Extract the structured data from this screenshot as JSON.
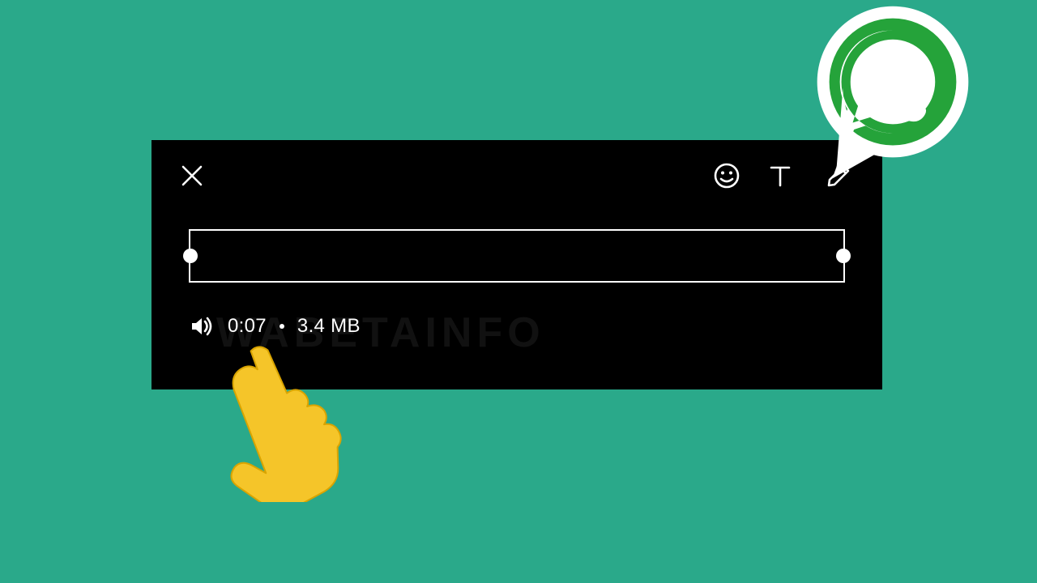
{
  "media": {
    "duration": "0:07",
    "size": "3.4 MB"
  },
  "watermark": "WABETAINFO",
  "icons": {
    "close": "close-icon",
    "emoji": "emoji-icon",
    "text": "text-tool-icon",
    "pencil": "pencil-icon",
    "volume": "volume-icon",
    "hand": "pointing-hand-icon",
    "logo": "whatsapp-logo-icon"
  }
}
